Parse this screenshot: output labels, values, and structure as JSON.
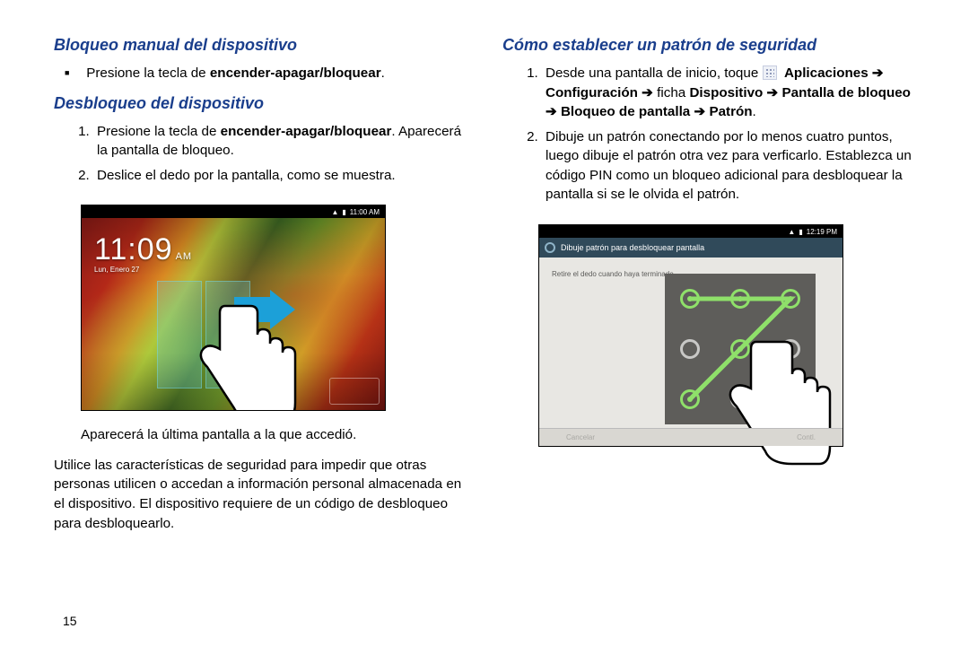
{
  "left": {
    "h1": "Bloqueo manual del dispositivo",
    "bullet1_a": "Presione la tecla de ",
    "bullet1_b": "encender-apagar/bloquear",
    "bullet1_c": ".",
    "h2": "Desbloqueo del dispositivo",
    "step1_a": "Presione la tecla de ",
    "step1_b": "encender-apagar/bloquear",
    "step1_c": ". Aparecerá la pantalla de bloqueo.",
    "step2": "Deslice el dedo por la pantalla, como se muestra.",
    "screenshot_time": "11:00 AM",
    "clock_time": "11:09",
    "clock_ampm": "AM",
    "clock_date": "Lun, Enero 27",
    "after1": "Aparecerá la última pantalla a la que accedió.",
    "after2": "Utilice las características de seguridad para impedir que otras personas utilicen o accedan a información personal almacenada en el dispositivo. El dispositivo requiere de un código de desbloqueo para desbloquearlo.",
    "pagenum": "15"
  },
  "right": {
    "h1": "Cómo establecer un patrón de seguridad",
    "step1_a": "Desde una pantalla de inicio, toque ",
    "step1_b": "Aplicaciones",
    "step1_c": "Configuración",
    "step1_d": " ficha ",
    "step1_e": "Dispositivo",
    "step1_f": "Pantalla de bloqueo",
    "step1_g": "Bloqueo de pantalla",
    "step1_h": "Patrón",
    "step2": "Dibuje un patrón conectando por lo menos cuatro puntos, luego dibuje el patrón otra vez para verficarlo. Establezca un código PIN como un bloqueo adicional para desbloquear la pantalla si se le olvida el patrón.",
    "screenshot_time": "12:19 PM",
    "screenshot_header": "Dibuje patrón para desbloquear pantalla",
    "instruction": "Retire el dedo cuando haya terminado",
    "footer_left": "Cancelar",
    "footer_right": "Contl."
  }
}
